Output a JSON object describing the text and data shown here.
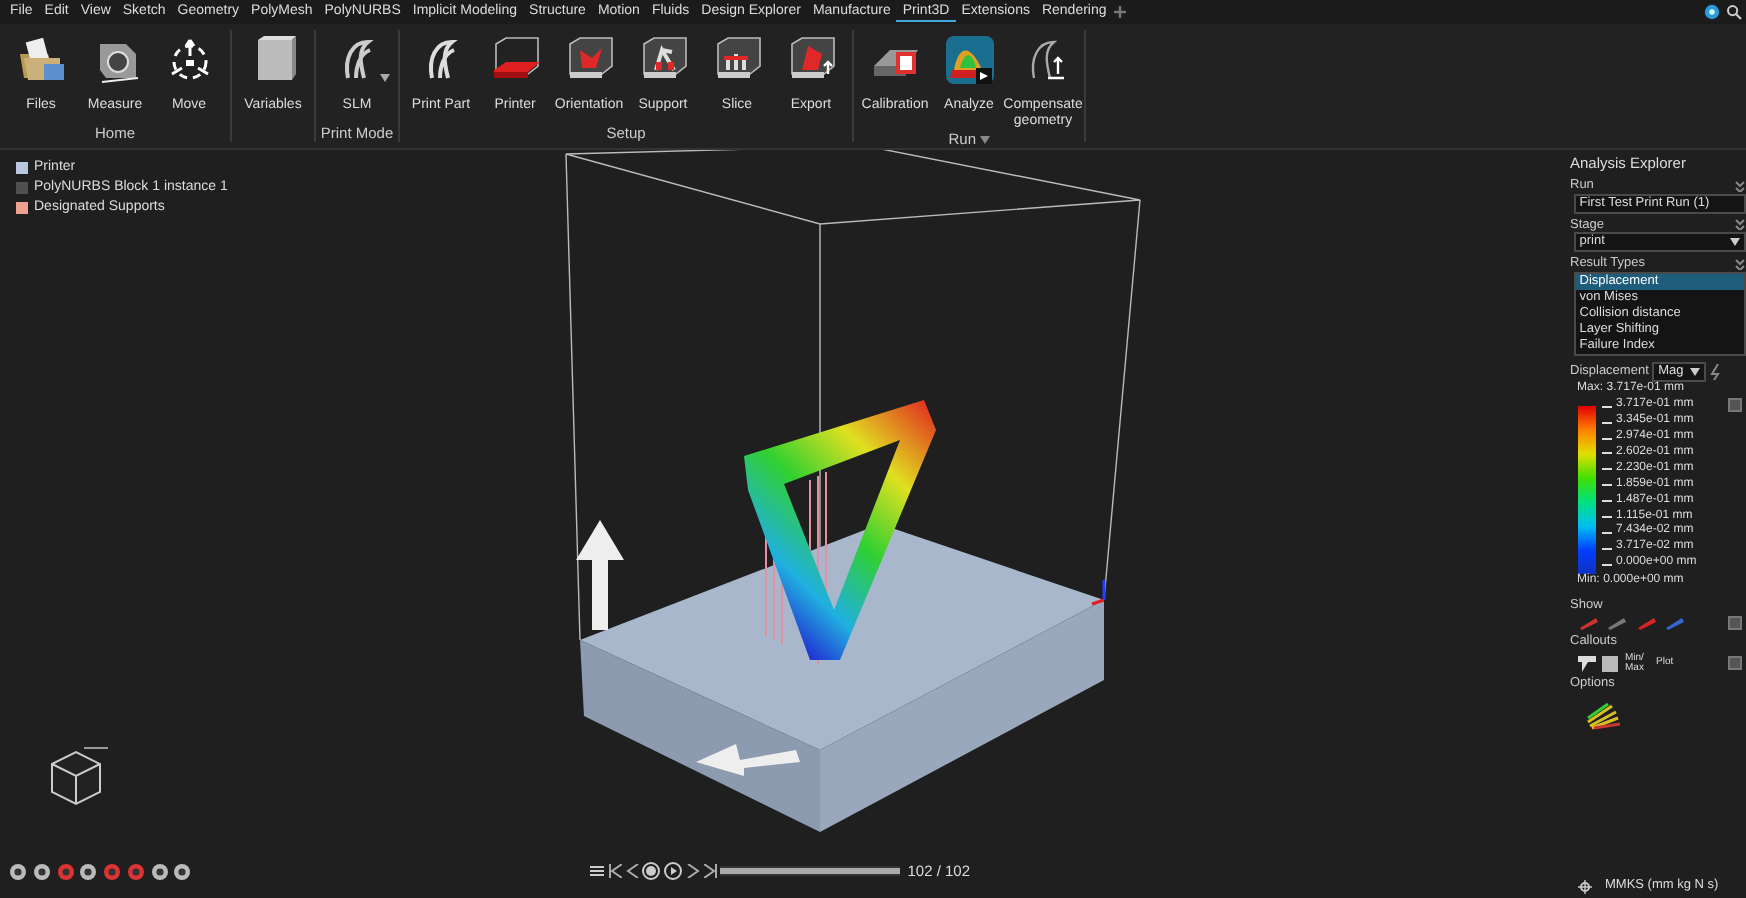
{
  "menu": [
    {
      "label": "File",
      "selected": false
    },
    {
      "label": "Edit",
      "selected": false
    },
    {
      "label": "View",
      "selected": false
    },
    {
      "label": "Sketch",
      "selected": false
    },
    {
      "label": "Geometry",
      "selected": false
    },
    {
      "label": "PolyMesh",
      "selected": false
    },
    {
      "label": "PolyNURBS",
      "selected": false
    },
    {
      "label": "Implicit Modeling",
      "selected": false
    },
    {
      "label": "Structure",
      "selected": false
    },
    {
      "label": "Motion",
      "selected": false
    },
    {
      "label": "Fluids",
      "selected": false
    },
    {
      "label": "Design Explorer",
      "selected": false
    },
    {
      "label": "Manufacture",
      "selected": false
    },
    {
      "label": "Print3D",
      "selected": true
    },
    {
      "label": "Extensions",
      "selected": false
    },
    {
      "label": "Rendering",
      "selected": false
    }
  ],
  "ribbon": [
    {
      "label": "Home",
      "tools": [
        {
          "label": "Files"
        },
        {
          "label": "Measure"
        },
        {
          "label": "Move"
        }
      ]
    },
    {
      "tools": [
        {
          "label": "Variables"
        }
      ]
    },
    {
      "label": "Print Mode",
      "tools": [
        {
          "label": "SLM",
          "dropdown": true
        }
      ]
    },
    {
      "label": "Setup",
      "tools": [
        {
          "label": "Print Part"
        },
        {
          "label": "Printer"
        },
        {
          "label": "Orientation"
        },
        {
          "label": "Support"
        },
        {
          "label": "Slice"
        },
        {
          "label": "Export"
        }
      ]
    },
    {
      "label": "Run",
      "dropdown": true,
      "tools": [
        {
          "label": "Calibration"
        },
        {
          "label": "Analyze"
        },
        {
          "label": "Compensate geometry"
        }
      ]
    }
  ],
  "tree": [
    {
      "label": "Printer",
      "color": "#b8c8e0"
    },
    {
      "label": "PolyNURBS Block 1  instance 1",
      "color": "#505050"
    },
    {
      "label": "Designated Supports",
      "color": "#f0a090"
    }
  ],
  "analysis_explorer": {
    "title": "Analysis Explorer",
    "run": {
      "label": "Run",
      "value": "First Test Print Run (1)"
    },
    "stage": {
      "label": "Stage",
      "value": "print"
    },
    "result_types": {
      "label": "Result Types",
      "items": [
        {
          "label": "Displacement",
          "selected": true
        },
        {
          "label": "von Mises",
          "selected": false
        },
        {
          "label": "Collision distance",
          "selected": false
        },
        {
          "label": "Layer Shifting",
          "selected": false
        },
        {
          "label": "Failure Index",
          "selected": false
        }
      ]
    },
    "legend": {
      "label": "Displacement",
      "mode": "Mag",
      "max_label": "Max:",
      "max": "3.717e-01 mm",
      "ticks": [
        "3.717e-01 mm",
        "3.345e-01 mm",
        "2.974e-01 mm",
        "2.602e-01 mm",
        "2.230e-01 mm",
        "1.859e-01 mm",
        "1.487e-01 mm",
        "1.115e-01 mm",
        "7.434e-02 mm",
        "3.717e-02 mm",
        "0.000e+00 mm"
      ],
      "min_label": "Min:",
      "min": "0.000e+00 mm"
    },
    "show": {
      "label": "Show"
    },
    "callouts": {
      "label": "Callouts",
      "buttons": [
        "Min/ Max",
        "Plot"
      ]
    },
    "options": {
      "label": "Options"
    }
  },
  "playback": {
    "level": 1,
    "frame": "102 / 102"
  },
  "status_bar": {
    "units": "MMKS (mm kg N s)"
  }
}
